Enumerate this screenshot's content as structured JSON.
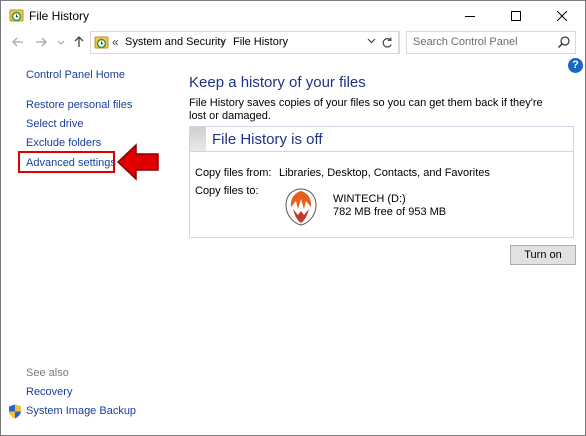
{
  "window": {
    "title": "File History"
  },
  "address": {
    "separator": "«",
    "crumbs": [
      "System and Security",
      "File History"
    ],
    "crumb_sep": "›"
  },
  "search": {
    "placeholder": "Search Control Panel"
  },
  "sidebar": {
    "home": "Control Panel Home",
    "items": [
      {
        "label": "Restore personal files"
      },
      {
        "label": "Select drive"
      },
      {
        "label": "Exclude folders"
      },
      {
        "label": "Advanced settings"
      }
    ],
    "see_also_heading": "See also",
    "see_also": [
      {
        "label": "Recovery"
      },
      {
        "label": "System Image Backup"
      }
    ]
  },
  "main": {
    "title": "Keep a history of your files",
    "description": "File History saves copies of your files so you can get them back if they're lost or damaged.",
    "status_title": "File History is off",
    "copy_from_label": "Copy files from:",
    "copy_from_value": "Libraries, Desktop, Contacts, and Favorites",
    "copy_to_label": "Copy files to:",
    "drive_name": "WINTECH (D:)",
    "drive_free": "782 MB free of 953 MB",
    "turn_on_label": "Turn on"
  },
  "colors": {
    "link": "#1a3e9c",
    "heading": "#1e3287",
    "highlight": "#e00000"
  }
}
